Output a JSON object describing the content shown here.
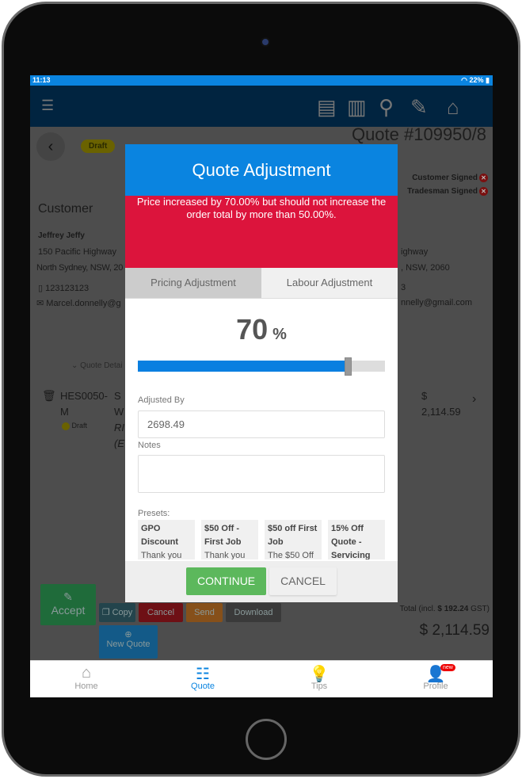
{
  "status": {
    "time": "11:13",
    "battery": "22%"
  },
  "header": {
    "icons": [
      "menu-icon",
      "document-icon",
      "book-icon",
      "search-icon",
      "edit-icon",
      "home-icon"
    ]
  },
  "quote": {
    "badge": "Draft",
    "title": "Quote #109950/8",
    "customer_signed": "Customer Signed",
    "tradesman_signed": "Tradesman Signed"
  },
  "customer": {
    "heading": "Customer",
    "name": "Jeffrey Jeffy",
    "address1": "150 Pacific Highway",
    "address2": "North Sydney, NSW, 20",
    "phone": "123123123",
    "email": "Marcel.donnelly@g",
    "right_address1": "ighway",
    "right_address2": ", NSW, 2060",
    "right_phone": "3",
    "right_email": "nnelly@gmail.com"
  },
  "details_toggle": "Quote Detai",
  "line_item": {
    "code": "HES0050-",
    "code2": "M",
    "status": "Draft",
    "desc1": "S",
    "desc2": "W",
    "desc3": "RI",
    "desc4": "(E",
    "price_symbol": "$",
    "price": "2,114.59"
  },
  "actions": {
    "accept": "Accept",
    "copy": "Copy",
    "cancel": "Cancel",
    "send": "Send",
    "download": "Download",
    "new_quote": "New Quote"
  },
  "totals": {
    "label": "Total (incl. ",
    "gst": "$ 192.24",
    "gst_suffix": " GST)",
    "total": "$ 2,114.59"
  },
  "modal": {
    "title": "Quote Adjustment",
    "error": "Price increased by 70.00% but should not increase the order total by more than 50.00%.",
    "tabs": [
      {
        "label": "Pricing Adjustment",
        "active": true
      },
      {
        "label": "Labour Adjustment",
        "active": false
      }
    ],
    "percent_value": "70",
    "percent_sign": "%",
    "slider_value_fraction": 0.85,
    "adjusted_by_label": "Adjusted By",
    "adjusted_by_value": "2698.49",
    "notes_label": "Notes",
    "notes_value": "",
    "presets_label": "Presets:",
    "presets": [
      {
        "title": "GPO Discount",
        "desc": "Thank you for"
      },
      {
        "title": "$50 Off - First Job",
        "desc": "Thank you for"
      },
      {
        "title": "$50 off First Job",
        "desc": "The $50 Off"
      },
      {
        "title": "15% Off Quote - Servicing Air",
        "desc": ""
      }
    ],
    "continue": "CONTINUE",
    "cancel": "CANCEL"
  },
  "nav": [
    {
      "label": "Home",
      "active": false
    },
    {
      "label": "Quote",
      "active": true
    },
    {
      "label": "Tips",
      "active": false
    },
    {
      "label": "Profile",
      "active": false,
      "badge": "new"
    }
  ],
  "colors": {
    "primary": "#0a84e0",
    "error": "#dc143c",
    "success": "#5cb85c"
  }
}
